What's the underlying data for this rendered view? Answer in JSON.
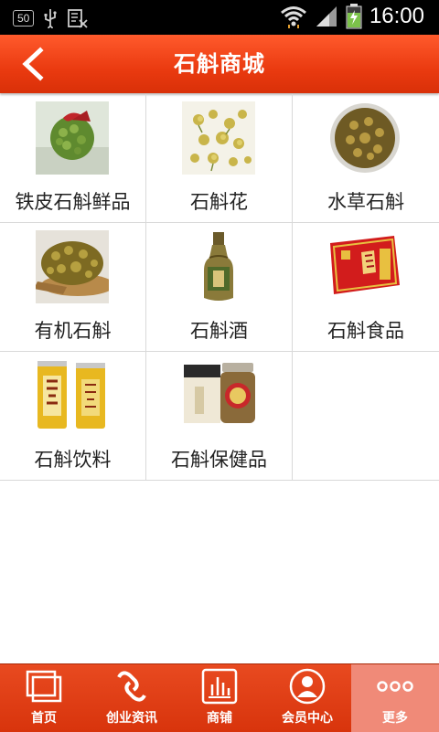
{
  "status_bar": {
    "time": "16:00",
    "badge": "50"
  },
  "header": {
    "title": "石斛商城"
  },
  "products": [
    {
      "label": "铁皮石斛鲜品",
      "icon": "fresh-dendrobium-image"
    },
    {
      "label": "石斛花",
      "icon": "dendrobium-flower-image"
    },
    {
      "label": "水草石斛",
      "icon": "grass-dendrobium-image"
    },
    {
      "label": "有机石斛",
      "icon": "organic-dendrobium-image"
    },
    {
      "label": "石斛酒",
      "icon": "dendrobium-wine-image"
    },
    {
      "label": "石斛食品",
      "icon": "dendrobium-food-image"
    },
    {
      "label": "石斛饮料",
      "icon": "dendrobium-drink-image"
    },
    {
      "label": "石斛保健品",
      "icon": "dendrobium-health-image"
    }
  ],
  "bottom_nav": [
    {
      "label": "首页",
      "icon": "home-icon"
    },
    {
      "label": "创业资讯",
      "icon": "link-icon"
    },
    {
      "label": "商铺",
      "icon": "chart-icon"
    },
    {
      "label": "会员中心",
      "icon": "user-icon"
    },
    {
      "label": "更多",
      "icon": "more-icon"
    }
  ],
  "colors": {
    "accent": "#e8421a",
    "active_tab": "#f08a78"
  }
}
